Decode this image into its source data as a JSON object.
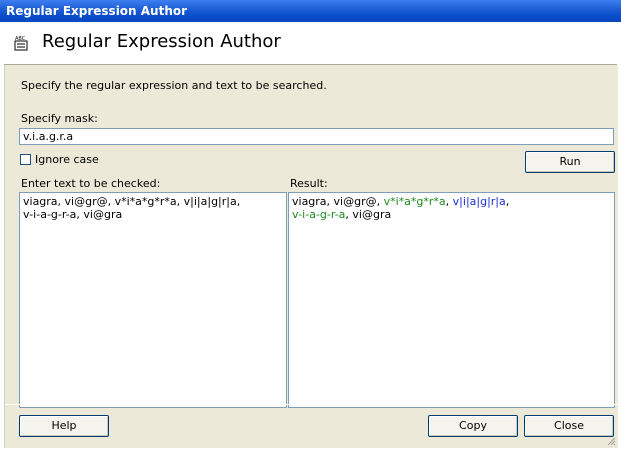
{
  "window": {
    "title": "Regular Expression Author"
  },
  "header": {
    "title": "Regular Expression Author",
    "icon": "abc-document-icon"
  },
  "instructions": "Specify the regular expression and text to be searched.",
  "mask": {
    "label": "Specify mask:",
    "value": "v.i.a.g.r.a"
  },
  "ignore_case": {
    "label": "Ignore case",
    "checked": false
  },
  "run_button": "Run",
  "input_text": {
    "label": "Enter text to be checked:",
    "value": "viagra, vi@gr@, v*i*a*g*r*a, v|i|a|g|r|a,\nv-i-a-g-r-a, vi@gra"
  },
  "result": {
    "label": "Result:",
    "segments": [
      {
        "text": "viagra, vi@gr@, ",
        "style": "plain"
      },
      {
        "text": "v*i*a*g*r*a",
        "style": "green"
      },
      {
        "text": ", ",
        "style": "plain"
      },
      {
        "text": "v|i|a|g|r|a",
        "style": "blue"
      },
      {
        "text": ",\n",
        "style": "plain"
      },
      {
        "text": "v-i-a-g-r-a",
        "style": "green"
      },
      {
        "text": ", vi@gra",
        "style": "plain"
      }
    ]
  },
  "buttons": {
    "help": "Help",
    "copy": "Copy",
    "close": "Close"
  },
  "colors": {
    "title_bar": "#0a4ecb",
    "match_green": "#1d8a1d",
    "match_blue": "#1a2ed6",
    "dialog_bg": "#ece9d8"
  }
}
